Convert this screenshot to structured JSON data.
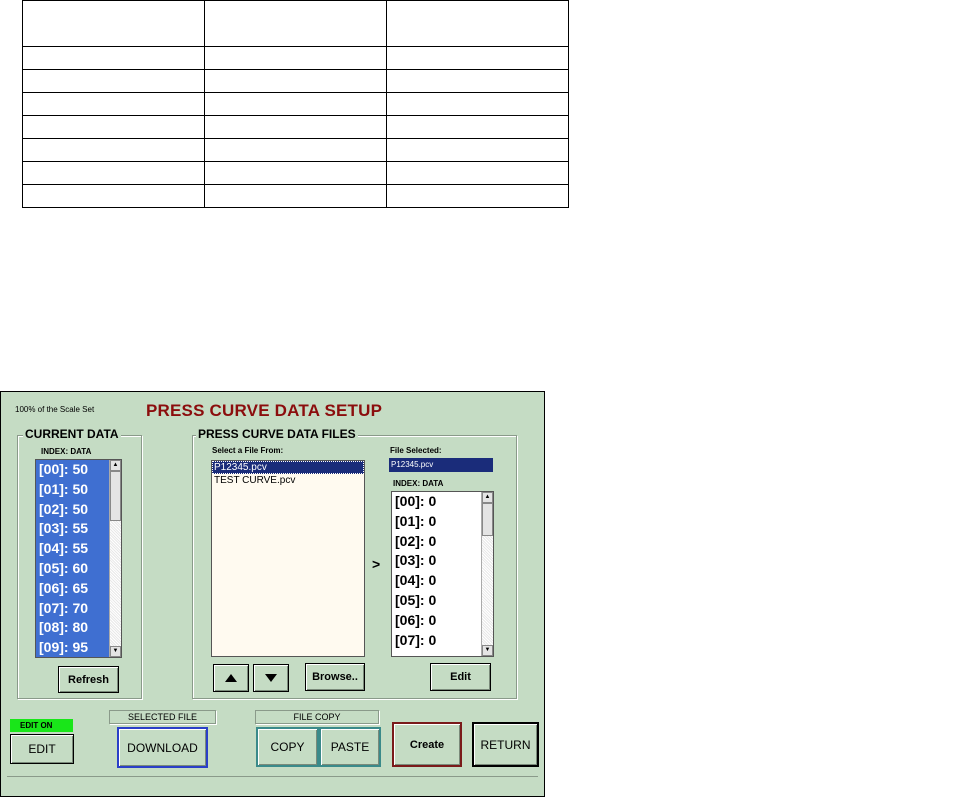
{
  "window": {
    "scale_note": "100% of the Scale Set",
    "title": "PRESS CURVE DATA SETUP"
  },
  "current_data": {
    "group_label": "CURRENT DATA",
    "col_header": "INDEX:  DATA",
    "items": [
      "[00]: 50",
      "[01]: 50",
      "[02]: 50",
      "[03]: 55",
      "[04]: 55",
      "[05]: 60",
      "[06]: 65",
      "[07]: 70",
      "[08]: 80",
      "[09]: 95"
    ],
    "refresh_label": "Refresh"
  },
  "files": {
    "group_label": "PRESS CURVE DATA FILES",
    "select_label": "Select a File From:",
    "list": [
      "P12345.pcv",
      "TEST CURVE.pcv"
    ],
    "selected_index": 0,
    "browse_label": "Browse..",
    "arrow": ">",
    "file_selected_label": "File Selected:",
    "file_selected_value": "P12345.pcv",
    "col_header": "INDEX:   DATA",
    "selected_items": [
      "[00]: 0",
      "[01]: 0",
      "[02]: 0",
      "[03]: 0",
      "[04]: 0",
      "[05]: 0",
      "[06]: 0",
      "[07]: 0"
    ],
    "edit_label": "Edit"
  },
  "bottom": {
    "edit_on": "EDIT ON",
    "edit_label": "EDIT",
    "selected_file_caption": "SELECTED FILE",
    "download_label": "DOWNLOAD",
    "file_copy_caption": "FILE COPY",
    "copy_label": "COPY",
    "paste_label": "PASTE",
    "create_label": "Create",
    "return_label": "RETURN"
  },
  "colors": {
    "background": "#c5dcc4",
    "title": "#8b0d0d",
    "list_selection": "#3f6fd1",
    "file_selected": "#1a2c7a",
    "edit_on": "#19e619",
    "download_border": "#2a3fc8",
    "copy_border": "#3a8a8a",
    "create_border": "#7a1a1a"
  }
}
